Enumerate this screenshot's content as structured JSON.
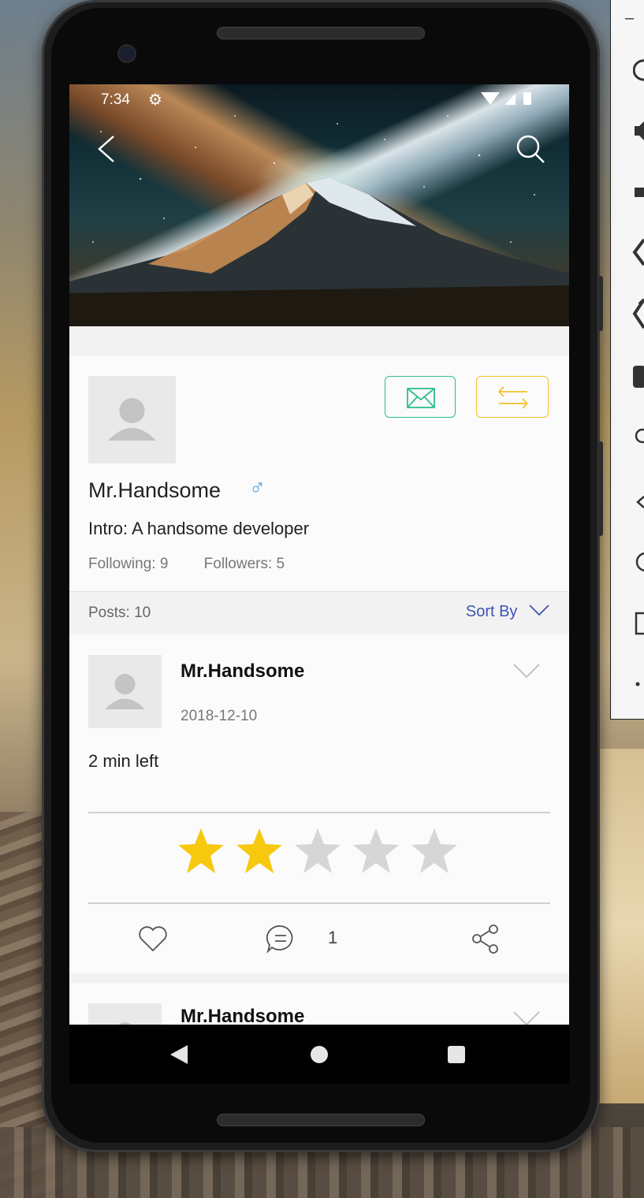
{
  "status_bar": {
    "time": "7:34"
  },
  "profile": {
    "name": "Mr.Handsome",
    "gender_symbol": "♂",
    "intro": "Intro: A handsome developer",
    "following": "Following: 9",
    "followers": "Followers: 5"
  },
  "posts_bar": {
    "count": "Posts: 10",
    "sort_label": "Sort By"
  },
  "posts": [
    {
      "author": "Mr.Handsome",
      "date": "2018-12-10",
      "text": "2 min left",
      "rating": 2,
      "rating_max": 5,
      "comment_count": "1"
    },
    {
      "author": "Mr.Handsome"
    }
  ],
  "colors": {
    "accent_blue": "#3d54b3",
    "message_green": "#2fbf87",
    "swap_yellow": "#f3c12c",
    "star_on": "#f6c90e",
    "star_off": "#d6d6d6"
  },
  "icons": [
    "back-arrow-icon",
    "search-icon",
    "mail-icon",
    "swap-arrows-icon",
    "male-icon",
    "chevron-down-icon",
    "heart-icon",
    "comment-icon",
    "share-icon"
  ]
}
